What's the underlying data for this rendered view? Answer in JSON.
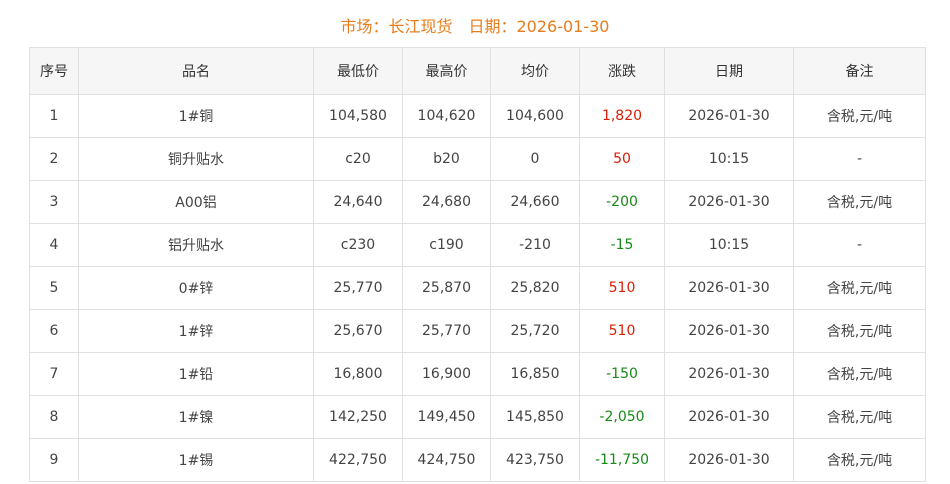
{
  "header": {
    "market_label": "市场：长江现货",
    "date_label": "日期：2026-01-30"
  },
  "colors": {
    "title": "#e57d1c",
    "up": "#d81e06",
    "down": "#178a17",
    "header_bg": "#f6f6f6",
    "border": "#e0e0e0"
  },
  "table": {
    "columns": [
      "序号",
      "品名",
      "最低价",
      "最高价",
      "均价",
      "涨跌",
      "日期",
      "备注"
    ],
    "rows": [
      {
        "no": "1",
        "name": "1#铜",
        "low": "104,580",
        "high": "104,620",
        "avg": "104,600",
        "change": "1,820",
        "trend": "up",
        "date": "2026-01-30",
        "note": "含税,元/吨"
      },
      {
        "no": "2",
        "name": "铜升贴水",
        "low": "c20",
        "high": "b20",
        "avg": "0",
        "change": "50",
        "trend": "up",
        "date": "10:15",
        "note": "-"
      },
      {
        "no": "3",
        "name": "A00铝",
        "low": "24,640",
        "high": "24,680",
        "avg": "24,660",
        "change": "-200",
        "trend": "down",
        "date": "2026-01-30",
        "note": "含税,元/吨"
      },
      {
        "no": "4",
        "name": "铝升贴水",
        "low": "c230",
        "high": "c190",
        "avg": "-210",
        "change": "-15",
        "trend": "down",
        "date": "10:15",
        "note": "-"
      },
      {
        "no": "5",
        "name": "0#锌",
        "low": "25,770",
        "high": "25,870",
        "avg": "25,820",
        "change": "510",
        "trend": "up",
        "date": "2026-01-30",
        "note": "含税,元/吨"
      },
      {
        "no": "6",
        "name": "1#锌",
        "low": "25,670",
        "high": "25,770",
        "avg": "25,720",
        "change": "510",
        "trend": "up",
        "date": "2026-01-30",
        "note": "含税,元/吨"
      },
      {
        "no": "7",
        "name": "1#铅",
        "low": "16,800",
        "high": "16,900",
        "avg": "16,850",
        "change": "-150",
        "trend": "down",
        "date": "2026-01-30",
        "note": "含税,元/吨"
      },
      {
        "no": "8",
        "name": "1#镍",
        "low": "142,250",
        "high": "149,450",
        "avg": "145,850",
        "change": "-2,050",
        "trend": "down",
        "date": "2026-01-30",
        "note": "含税,元/吨"
      },
      {
        "no": "9",
        "name": "1#锡",
        "low": "422,750",
        "high": "424,750",
        "avg": "423,750",
        "change": "-11,750",
        "trend": "down",
        "date": "2026-01-30",
        "note": "含税,元/吨"
      }
    ]
  }
}
